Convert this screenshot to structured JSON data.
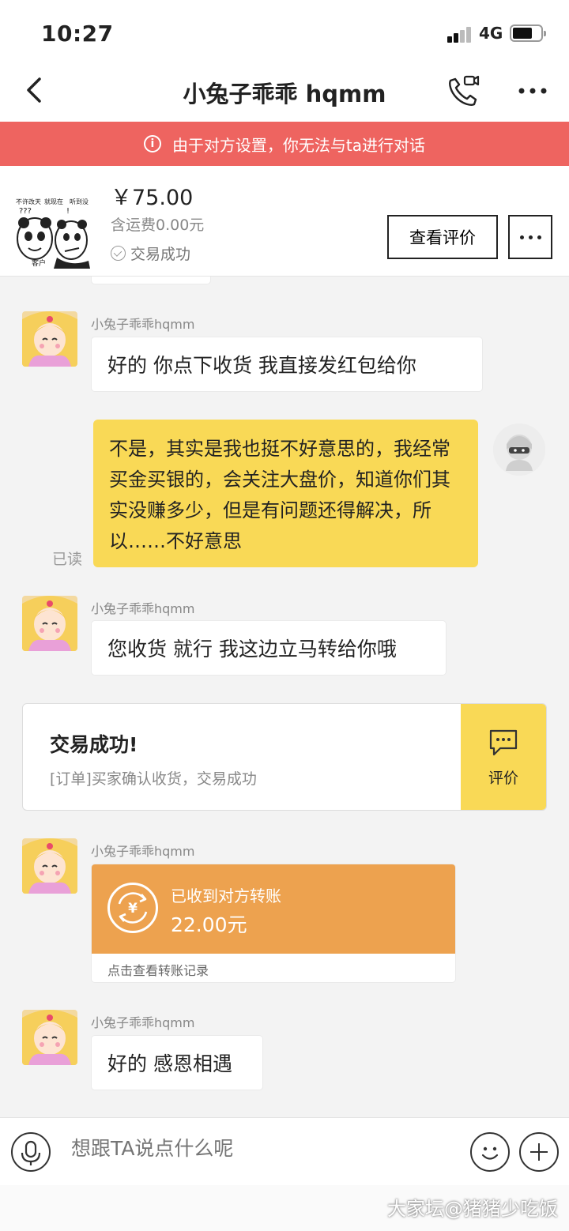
{
  "status_bar": {
    "time": "10:27",
    "network": "4G"
  },
  "nav": {
    "title": "小兔子乖乖 hqmm"
  },
  "banner": {
    "text": "由于对方设置，你无法与ta进行对话"
  },
  "product": {
    "thumb_text_1": "不许改天",
    "thumb_text_2": "就现在",
    "thumb_text_3": "听到没",
    "thumb_text_4": "客户",
    "price": "￥75.00",
    "shipping": "含运费0.00元",
    "status": "交易成功",
    "review_button": "查看评价"
  },
  "messages": [
    {
      "sender": "小兔子乖乖hqmm",
      "text": "好的  你点下收货  我直接发红包给你"
    },
    {
      "mine": true,
      "read": "已读",
      "text": "不是，其实是我也挺不好意思的，我经常买金买银的，会关注大盘价，知道你们其实没赚多少，但是有问题还得解决，所以……不好意思"
    },
    {
      "sender": "小兔子乖乖hqmm",
      "text": "您收货 就行 我这边立马转给你哦"
    },
    {
      "type": "trade",
      "title": "交易成功!",
      "subtitle": "[订单]买家确认收货，交易成功",
      "action": "评价"
    },
    {
      "sender": "小兔子乖乖hqmm",
      "type": "transfer",
      "label": "已收到对方转账",
      "amount": "22.00元",
      "footer": "点击查看转账记录"
    },
    {
      "sender": "小兔子乖乖hqmm",
      "text": "好的 感恩相遇"
    }
  ],
  "input": {
    "placeholder": "想跟TA说点什么呢"
  },
  "watermark": "大家坛@猪猪少吃饭",
  "colors": {
    "banner": "#ee6460",
    "my_bubble": "#f9d956",
    "transfer": "#eda24f"
  },
  "icons": [
    "back-icon",
    "video-call-icon",
    "more-icon",
    "info-icon",
    "check-circle-icon",
    "chat-eval-icon",
    "yuan-transfer-icon",
    "mic-icon",
    "emoji-icon",
    "plus-icon"
  ]
}
